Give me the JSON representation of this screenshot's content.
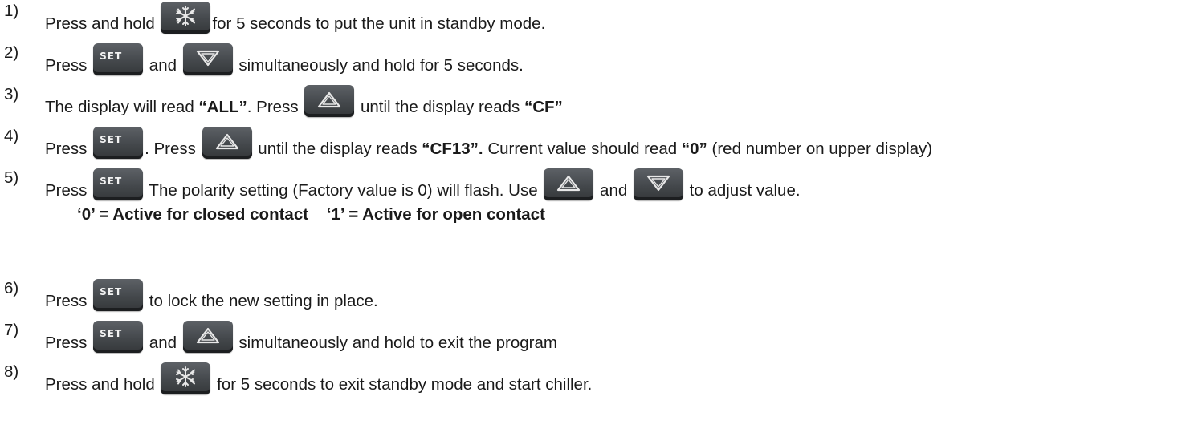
{
  "buttons": {
    "set_label": "SET"
  },
  "steps": [
    {
      "number": "1)",
      "parts": [
        "Press and hold ",
        "snowflake",
        "for 5 seconds to put the unit in standby mode."
      ]
    },
    {
      "number": "2)",
      "parts": [
        "Press ",
        "set",
        " and ",
        "down",
        " simultaneously and hold for 5 seconds."
      ]
    },
    {
      "number": "3)",
      "parts": [
        "The display will read ",
        "“ALL”",
        ". Press ",
        "up",
        " until the display reads ",
        "“CF”"
      ]
    },
    {
      "number": "4)",
      "parts": [
        "Press ",
        "set",
        ". Press ",
        "up",
        " until the display reads ",
        "“CF13”.",
        " Current value should read ",
        "“0”",
        " (red number on upper display)"
      ]
    },
    {
      "number": "5)",
      "parts": [
        "Press ",
        "set",
        " The polarity setting (Factory value is 0) will flash. Use ",
        "up",
        " and ",
        "down",
        " to adjust value."
      ],
      "rule": "‘0’ = Active for closed contact    ‘1’ = Active for open contact"
    },
    {
      "number": "6)",
      "parts": [
        "Press ",
        "set",
        " to lock the new setting in place."
      ]
    },
    {
      "number": "7)",
      "parts": [
        "Press ",
        "set",
        " and ",
        "up",
        " simultaneously and hold to exit the program"
      ]
    },
    {
      "number": "8)",
      "parts": [
        "Press and hold ",
        "snowflake",
        " for 5 seconds to exit standby mode and start chiller."
      ]
    }
  ]
}
